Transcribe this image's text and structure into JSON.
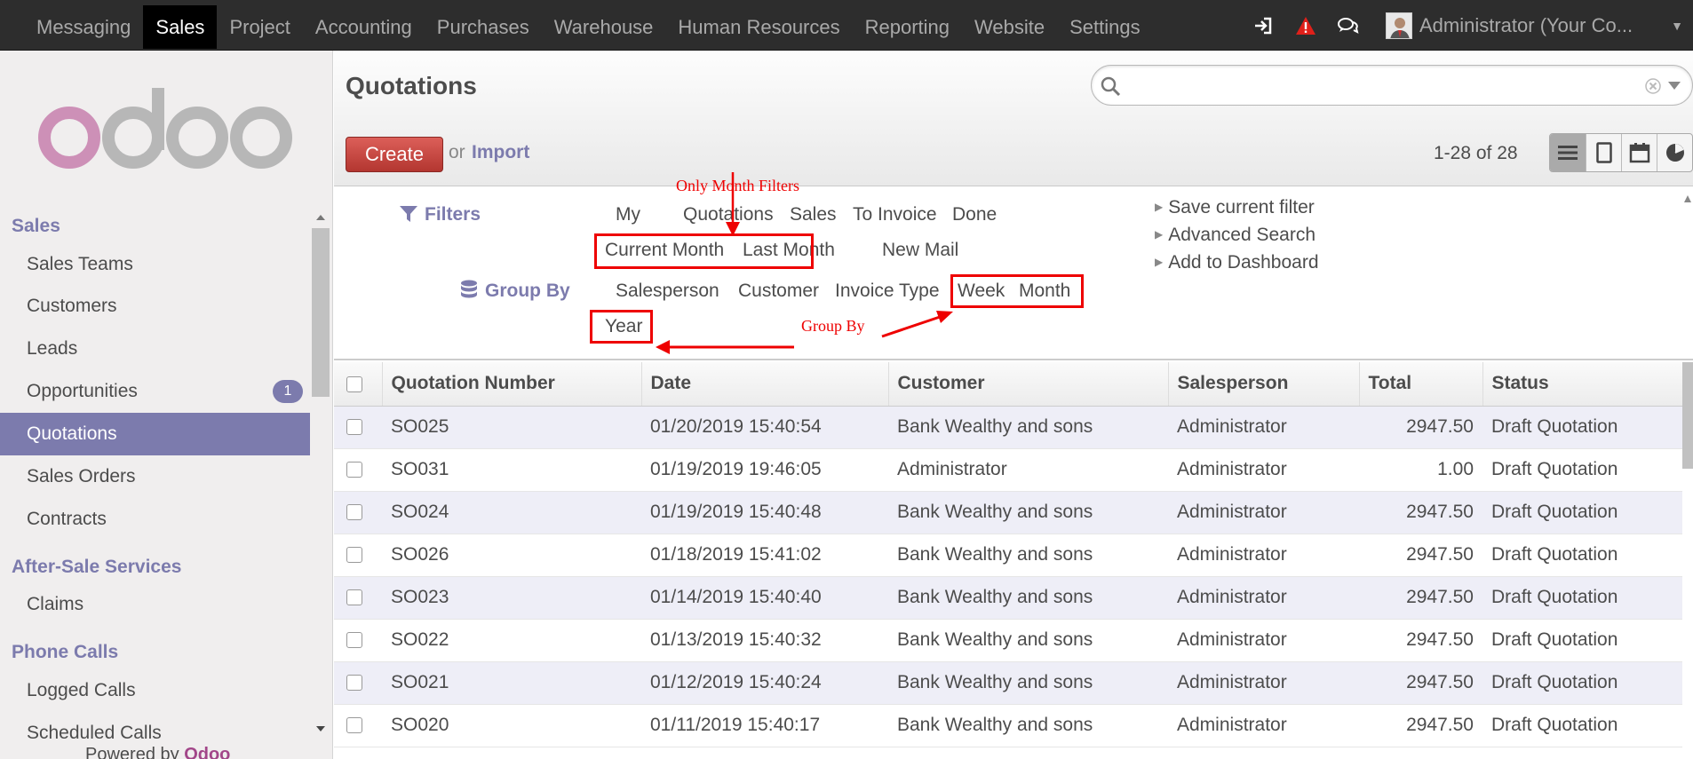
{
  "topnav": {
    "items": [
      "Messaging",
      "Sales",
      "Project",
      "Accounting",
      "Purchases",
      "Warehouse",
      "Human Resources",
      "Reporting",
      "Website",
      "Settings"
    ],
    "active": "Sales",
    "user": "Administrator (Your Co..."
  },
  "sidebar": {
    "logo": "odoo",
    "sections": [
      {
        "title": "Sales",
        "items": [
          "Sales Teams",
          "Customers",
          "Leads",
          "Opportunities",
          "Quotations",
          "Sales Orders",
          "Contracts"
        ]
      },
      {
        "title": "After-Sale Services",
        "items": [
          "Claims"
        ]
      },
      {
        "title": "Phone Calls",
        "items": [
          "Logged Calls",
          "Scheduled Calls"
        ]
      }
    ],
    "opportunities_badge": "1",
    "active": "Quotations",
    "powered_by": "Powered by",
    "powered_brand": "Odoo"
  },
  "header": {
    "title": "Quotations",
    "search_value": "",
    "create_label": "Create",
    "or_label": "or",
    "import_label": "Import",
    "pager": "1-28 of 28"
  },
  "filters": {
    "filters_label": "Filters",
    "group_by_label": "Group By",
    "filter_options": [
      "My",
      "Quotations",
      "Sales",
      "To Invoice",
      "Done"
    ],
    "month_filters": [
      "Current Month",
      "Last Month"
    ],
    "new_mail": "New Mail",
    "group_options": [
      "Salesperson",
      "Customer",
      "Invoice Type"
    ],
    "group_date": [
      "Week",
      "Month"
    ],
    "group_year": "Year",
    "advanced": [
      "Save current filter",
      "Advanced Search",
      "Add to Dashboard"
    ]
  },
  "annotations": {
    "month_filters": "Only Month Filters",
    "group_by": "Group By",
    "color": "#e00000"
  },
  "table": {
    "columns": [
      "Quotation Number",
      "Date",
      "Customer",
      "Salesperson",
      "Total",
      "Status"
    ],
    "rows": [
      [
        "SO025",
        "01/20/2019 15:40:54",
        "Bank Wealthy and sons",
        "Administrator",
        "2947.50",
        "Draft Quotation"
      ],
      [
        "SO031",
        "01/19/2019 19:46:05",
        "Administrator",
        "Administrator",
        "1.00",
        "Draft Quotation"
      ],
      [
        "SO024",
        "01/19/2019 15:40:48",
        "Bank Wealthy and sons",
        "Administrator",
        "2947.50",
        "Draft Quotation"
      ],
      [
        "SO026",
        "01/18/2019 15:41:02",
        "Bank Wealthy and sons",
        "Administrator",
        "2947.50",
        "Draft Quotation"
      ],
      [
        "SO023",
        "01/14/2019 15:40:40",
        "Bank Wealthy and sons",
        "Administrator",
        "2947.50",
        "Draft Quotation"
      ],
      [
        "SO022",
        "01/13/2019 15:40:32",
        "Bank Wealthy and sons",
        "Administrator",
        "2947.50",
        "Draft Quotation"
      ],
      [
        "SO021",
        "01/12/2019 15:40:24",
        "Bank Wealthy and sons",
        "Administrator",
        "2947.50",
        "Draft Quotation"
      ],
      [
        "SO020",
        "01/11/2019 15:40:17",
        "Bank Wealthy and sons",
        "Administrator",
        "2947.50",
        "Draft Quotation"
      ]
    ]
  },
  "colors": {
    "accent": "#7c7bad",
    "create": "#c9413b",
    "topbar": "#2d2d2d",
    "alert": "#e0201a"
  }
}
